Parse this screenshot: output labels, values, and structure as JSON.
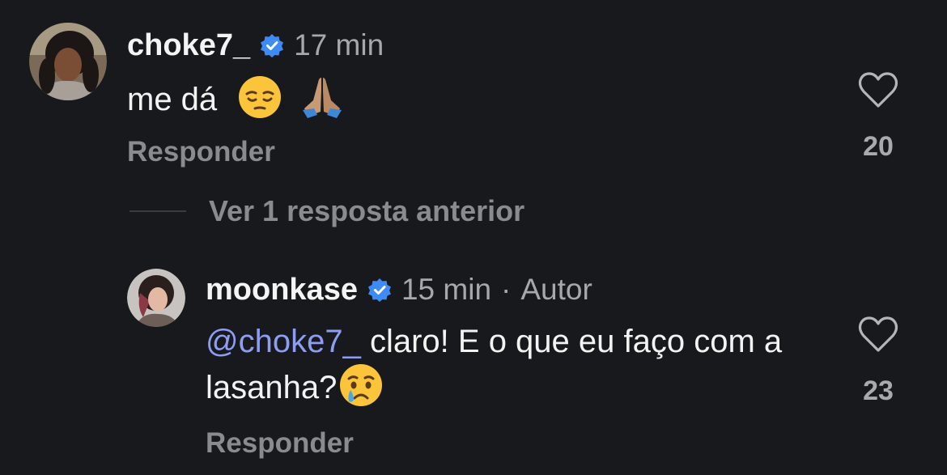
{
  "comments": [
    {
      "username": "choke7_",
      "verified": true,
      "time": "17 min",
      "text": "me dá",
      "emojis": [
        "pensive-face",
        "folded-hands"
      ],
      "reply_label": "Responder",
      "likes": "20"
    },
    {
      "username": "moonkase",
      "verified": true,
      "time": "15 min",
      "separator": "·",
      "author_tag": "Autor",
      "mention": "@choke7_",
      "text": "claro! E o que eu faço com a lasanha?",
      "emojis": [
        "crying-face"
      ],
      "reply_label": "Responder",
      "likes": "23"
    }
  ],
  "thread": {
    "view_previous_label": "Ver 1 resposta anterior"
  },
  "colors": {
    "background": "#18191c",
    "mention": "#8e9df2",
    "verified": "#3f8bf5",
    "muted": "#8a8b8e"
  }
}
